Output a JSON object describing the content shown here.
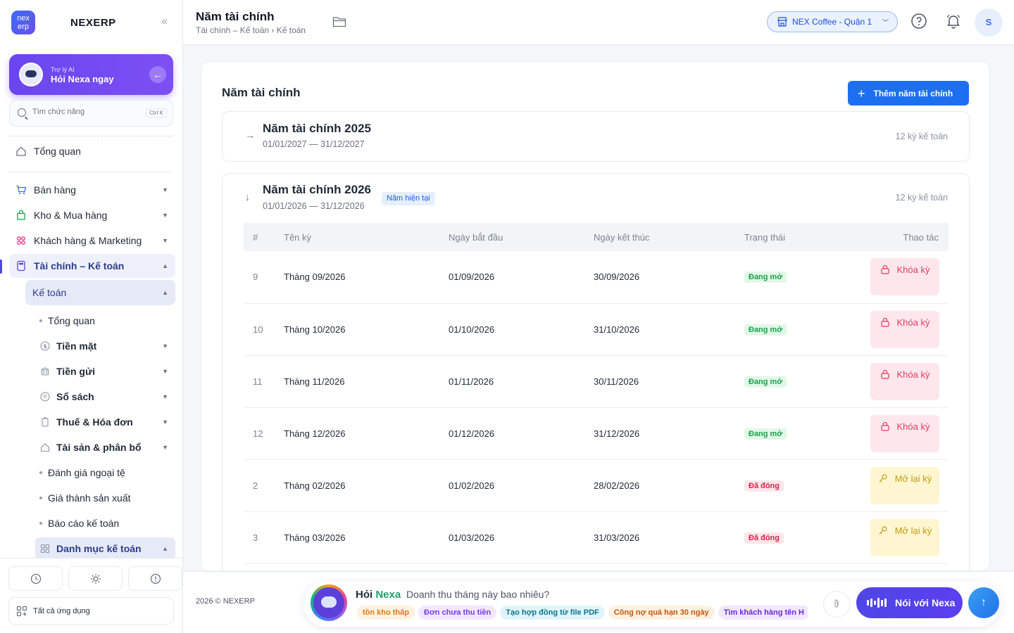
{
  "brand": {
    "logo_text": "nex erp",
    "name": "NEXERP"
  },
  "ai_assistant": {
    "small": "Trợ lý AI",
    "title": "Hỏi Nexa ngay"
  },
  "search": {
    "placeholder": "Tìm chức năng",
    "shortcut": "Ctrl K"
  },
  "nav": {
    "overview": "Tổng quan",
    "sales": "Bán hàng",
    "inventory": "Kho & Mua hàng",
    "crm": "Khách hàng & Marketing",
    "finance": "Tài chính – Kế toán",
    "accounting": "Kế toán",
    "leaves": [
      {
        "label": "Tổng quan"
      },
      {
        "label": "Tiền mặt"
      },
      {
        "label": "Tiền gửi"
      },
      {
        "label": "Sổ sách"
      },
      {
        "label": "Thuế & Hóa đơn"
      },
      {
        "label": "Tài sản & phân bổ"
      },
      {
        "label": "Đánh giá ngoại tệ"
      },
      {
        "label": "Giá thành sản xuất"
      },
      {
        "label": "Báo cáo kế toán"
      },
      {
        "label": "Danh mục kế toán"
      }
    ],
    "all_apps": "Tất cả ứng dụng"
  },
  "header": {
    "title": "Năm tài chính",
    "breadcrumb": "Tài chính – Kế toán › Kế toán",
    "store": "NEX Coffee - Quận 1",
    "avatar": "S"
  },
  "main": {
    "title": "Năm tài chính",
    "add_button": "Thêm năm tài chính",
    "years": [
      {
        "name": "Năm tài chính 2025",
        "dates": "01/01/2027 — 31/12/2027",
        "count": "12 kỳ kế toán"
      },
      {
        "name": "Năm tài chính 2026",
        "dates": "01/01/2026 — 31/12/2026",
        "count": "12 kỳ kế toán",
        "badge": "Năm hiện tại"
      }
    ],
    "table": {
      "headers": [
        "#",
        "Tên kỳ",
        "Ngày bắt đầu",
        "Ngày kết thúc",
        "Trạng thái",
        "Thao tác"
      ],
      "rows": [
        {
          "idx": "9",
          "name": "Tháng 09/2026",
          "start": "01/09/2026",
          "end": "30/09/2026",
          "status": "Đang mở",
          "action": "Khóa kỳ"
        },
        {
          "idx": "10",
          "name": "Tháng 10/2026",
          "start": "01/10/2026",
          "end": "31/10/2026",
          "status": "Đang mở",
          "action": "Khóa kỳ"
        },
        {
          "idx": "11",
          "name": "Tháng 11/2026",
          "start": "01/11/2026",
          "end": "30/11/2026",
          "status": "Đang mở",
          "action": "Khóa kỳ"
        },
        {
          "idx": "12",
          "name": "Tháng 12/2026",
          "start": "01/12/2026",
          "end": "31/12/2026",
          "status": "Đang mở",
          "action": "Khóa kỳ"
        },
        {
          "idx": "2",
          "name": "Tháng 02/2026",
          "start": "01/02/2026",
          "end": "28/02/2026",
          "status": "Đã đóng",
          "action": "Mở lại kỳ"
        },
        {
          "idx": "3",
          "name": "Tháng 03/2026",
          "start": "01/03/2026",
          "end": "31/03/2026",
          "status": "Đã đóng",
          "action": "Mở lại kỳ"
        }
      ]
    }
  },
  "footer": {
    "copyright": "2026 © NEXERP",
    "nexa_brand_1": "Hỏi",
    "nexa_brand_2": "Nexa",
    "nexa_placeholder": "Doanh thu tháng này bao nhiêu?",
    "chips": [
      {
        "label": "tồn kho thấp",
        "bg": "#fff1e0",
        "fg": "#e07a10"
      },
      {
        "label": "Đơn chưa thu tiền",
        "bg": "#f1e8ff",
        "fg": "#7c3aed"
      },
      {
        "label": "Tạo hợp đồng từ file PDF",
        "bg": "#e0f5fb",
        "fg": "#0e7490"
      },
      {
        "label": "Công nợ quá hạn 30 ngày",
        "bg": "#fff1e0",
        "fg": "#c2570c"
      },
      {
        "label": "Tìm khách hàng tên H",
        "bg": "#f1e8ff",
        "fg": "#6d28d9"
      }
    ],
    "talk_button": "Nói với Nexa",
    "send": "↑"
  },
  "colors": {
    "accent": "#1e6ff0",
    "ai": "#6a46f0",
    "open": "#15a34a",
    "closed": "#e11d48"
  }
}
